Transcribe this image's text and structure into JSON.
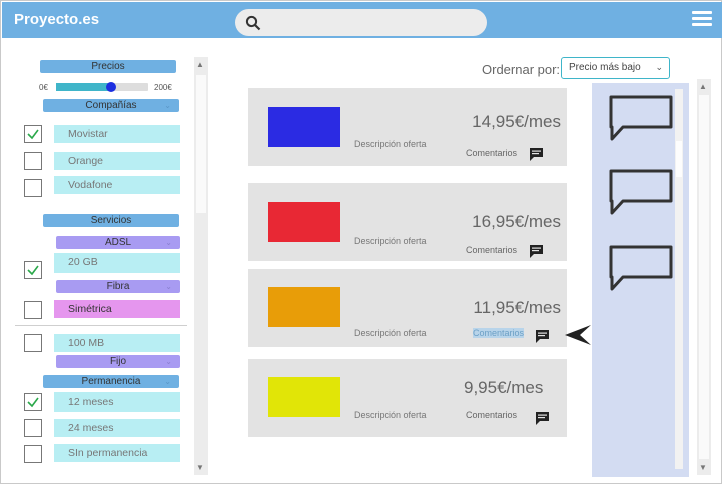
{
  "header": {
    "brand": "Proyecto.es"
  },
  "filters": {
    "price": {
      "title": "Precios",
      "min_label": "0€",
      "max_label": "200€",
      "value_fraction": 0.6
    },
    "companies": {
      "title": "Compañías",
      "options": [
        {
          "label": "Movistar",
          "checked": true
        },
        {
          "label": "Orange",
          "checked": false
        },
        {
          "label": "Vodafone",
          "checked": false
        }
      ]
    },
    "services": {
      "title": "Servicios",
      "adsl": {
        "title": "ADSL",
        "options": [
          {
            "label": "20 GB",
            "checked": true
          }
        ]
      },
      "fibra": {
        "title": "Fibra",
        "options": [
          {
            "label": "Simétrica",
            "checked": false
          },
          {
            "label": "100 MB",
            "checked": false
          }
        ]
      },
      "fijo": {
        "title": "Fijo"
      }
    },
    "permanence": {
      "title": "Permanencia",
      "options": [
        {
          "label": "12 meses",
          "checked": true
        },
        {
          "label": "24 meses",
          "checked": false
        },
        {
          "label": "SIn permanencia",
          "checked": false
        }
      ]
    }
  },
  "sort": {
    "label": "Ordernar por:",
    "selected": "Precio más bajo"
  },
  "offers": [
    {
      "color": "#2b2be3",
      "description": "Descripción oferta",
      "price": "14,95€/mes",
      "comments": "Comentarios",
      "highlighted": false
    },
    {
      "color": "#e82834",
      "description": "Descripción oferta",
      "price": "16,95€/mes",
      "comments": "Comentarios",
      "highlighted": false
    },
    {
      "color": "#e89d08",
      "description": "Descripción oferta",
      "price": "11,95€/mes",
      "comments": "Comentarios",
      "highlighted": true
    },
    {
      "color": "#e1e507",
      "description": "Descripción oferta",
      "price": "9,95€/mes",
      "comments": "Comentarios",
      "highlighted": false
    }
  ],
  "icons": {
    "search": "search-icon",
    "menu": "hamburger-menu-icon",
    "comment": "comment-icon",
    "speech_bubble": "speech-bubble-icon",
    "pointer": "arrow-pointer-icon",
    "check": "check-icon"
  },
  "colors": {
    "header": "#6fb0e2",
    "accent": "#3fb5c9",
    "option_bg": "#b8eef3",
    "purple": "#a89bf2",
    "pink": "#e596ee",
    "card_bg": "#e3e3e3",
    "panel_bg": "#d3dcf2"
  }
}
